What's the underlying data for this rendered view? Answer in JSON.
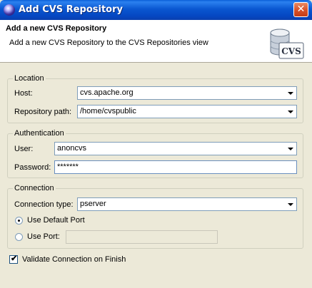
{
  "window": {
    "title": "Add CVS Repository",
    "close_symbol": "✕"
  },
  "banner": {
    "title": "Add a new CVS Repository",
    "description": "Add a new CVS Repository to the CVS Repositories view",
    "icon_text": "CVS"
  },
  "location": {
    "legend": "Location",
    "host_label": "Host:",
    "host_value": "cvs.apache.org",
    "path_label": "Repository path:",
    "path_value": "/home/cvspublic"
  },
  "authentication": {
    "legend": "Authentication",
    "user_label": "User:",
    "user_value": "anoncvs",
    "password_label": "Password:",
    "password_value": "*******"
  },
  "connection": {
    "legend": "Connection",
    "type_label": "Connection type:",
    "type_value": "pserver",
    "default_port_label": "Use Default Port",
    "default_port_selected": true,
    "use_port_label": "Use Port:",
    "use_port_value": ""
  },
  "validate": {
    "label": "Validate Connection on Finish",
    "checked": true,
    "check_mark": "✔"
  },
  "colors": {
    "titlebar": "#0a57d1",
    "dialog_bg": "#ece9d8",
    "input_border": "#7f9db9",
    "close_button": "#d9542c"
  }
}
